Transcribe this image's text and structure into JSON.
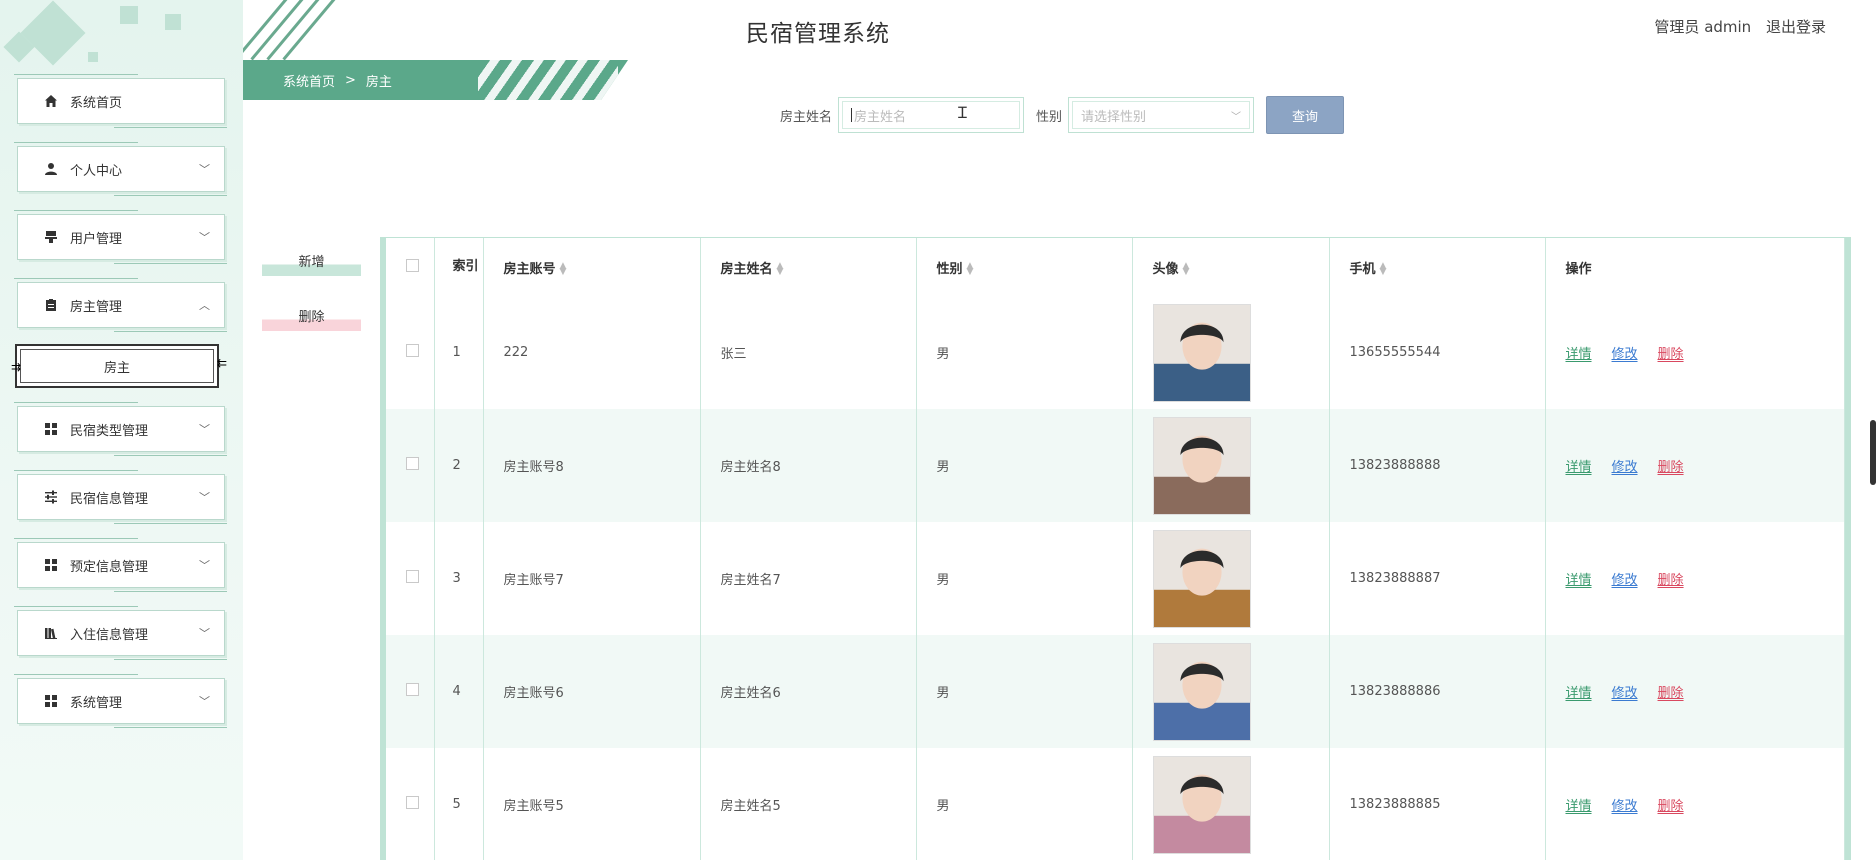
{
  "app": {
    "title": "民宿管理系统"
  },
  "user": {
    "role_label": "管理员 admin",
    "logout_label": "退出登录"
  },
  "breadcrumb": {
    "home": "系统首页",
    "separator": ">",
    "current": "房主"
  },
  "search": {
    "name_label": "房主姓名",
    "name_placeholder": "房主姓名",
    "gender_label": "性别",
    "gender_placeholder": "请选择性别",
    "query_label": "查询"
  },
  "actions": {
    "add_label": "新增",
    "delete_label": "删除"
  },
  "sidebar": {
    "items": [
      {
        "label": "系统首页",
        "icon": "home-icon",
        "chevron": ""
      },
      {
        "label": "个人中心",
        "icon": "user-icon",
        "chevron": "﹀"
      },
      {
        "label": "用户管理",
        "icon": "stamp-icon",
        "chevron": "﹀"
      },
      {
        "label": "房主管理",
        "icon": "clipboard-icon",
        "chevron": "︿"
      },
      {
        "label": "民宿类型管理",
        "icon": "grid-icon",
        "chevron": "﹀"
      },
      {
        "label": "民宿信息管理",
        "icon": "sliders-icon",
        "chevron": "﹀"
      },
      {
        "label": "预定信息管理",
        "icon": "grid-icon",
        "chevron": "﹀"
      },
      {
        "label": "入住信息管理",
        "icon": "library-icon",
        "chevron": "﹀"
      },
      {
        "label": "系统管理",
        "icon": "grid-icon",
        "chevron": "﹀"
      }
    ],
    "submenu_label": "房主"
  },
  "table": {
    "headers": {
      "index": "索引",
      "account": "房主账号",
      "name": "房主姓名",
      "gender": "性别",
      "avatar": "头像",
      "phone": "手机",
      "ops": "操作"
    },
    "op_labels": {
      "detail": "详情",
      "edit": "修改",
      "remove": "删除"
    },
    "rows": [
      {
        "index": "1",
        "account": "222",
        "name": "张三",
        "gender": "男",
        "phone": "13655555544",
        "avatar_hue": "#3b5f86"
      },
      {
        "index": "2",
        "account": "房主账号8",
        "name": "房主姓名8",
        "gender": "男",
        "phone": "13823888888",
        "avatar_hue": "#8a6b5c"
      },
      {
        "index": "3",
        "account": "房主账号7",
        "name": "房主姓名7",
        "gender": "男",
        "phone": "13823888887",
        "avatar_hue": "#b07a3c"
      },
      {
        "index": "4",
        "account": "房主账号6",
        "name": "房主姓名6",
        "gender": "男",
        "phone": "13823888886",
        "avatar_hue": "#4d6fa8"
      },
      {
        "index": "5",
        "account": "房主账号5",
        "name": "房主姓名5",
        "gender": "男",
        "phone": "13823888885",
        "avatar_hue": "#c48aa0"
      }
    ]
  },
  "colors": {
    "accent": "#5ba88a",
    "query_button": "#8ca4c4",
    "detail": "#3a9a6e",
    "edit": "#3b7bd1",
    "remove": "#d9485f"
  }
}
